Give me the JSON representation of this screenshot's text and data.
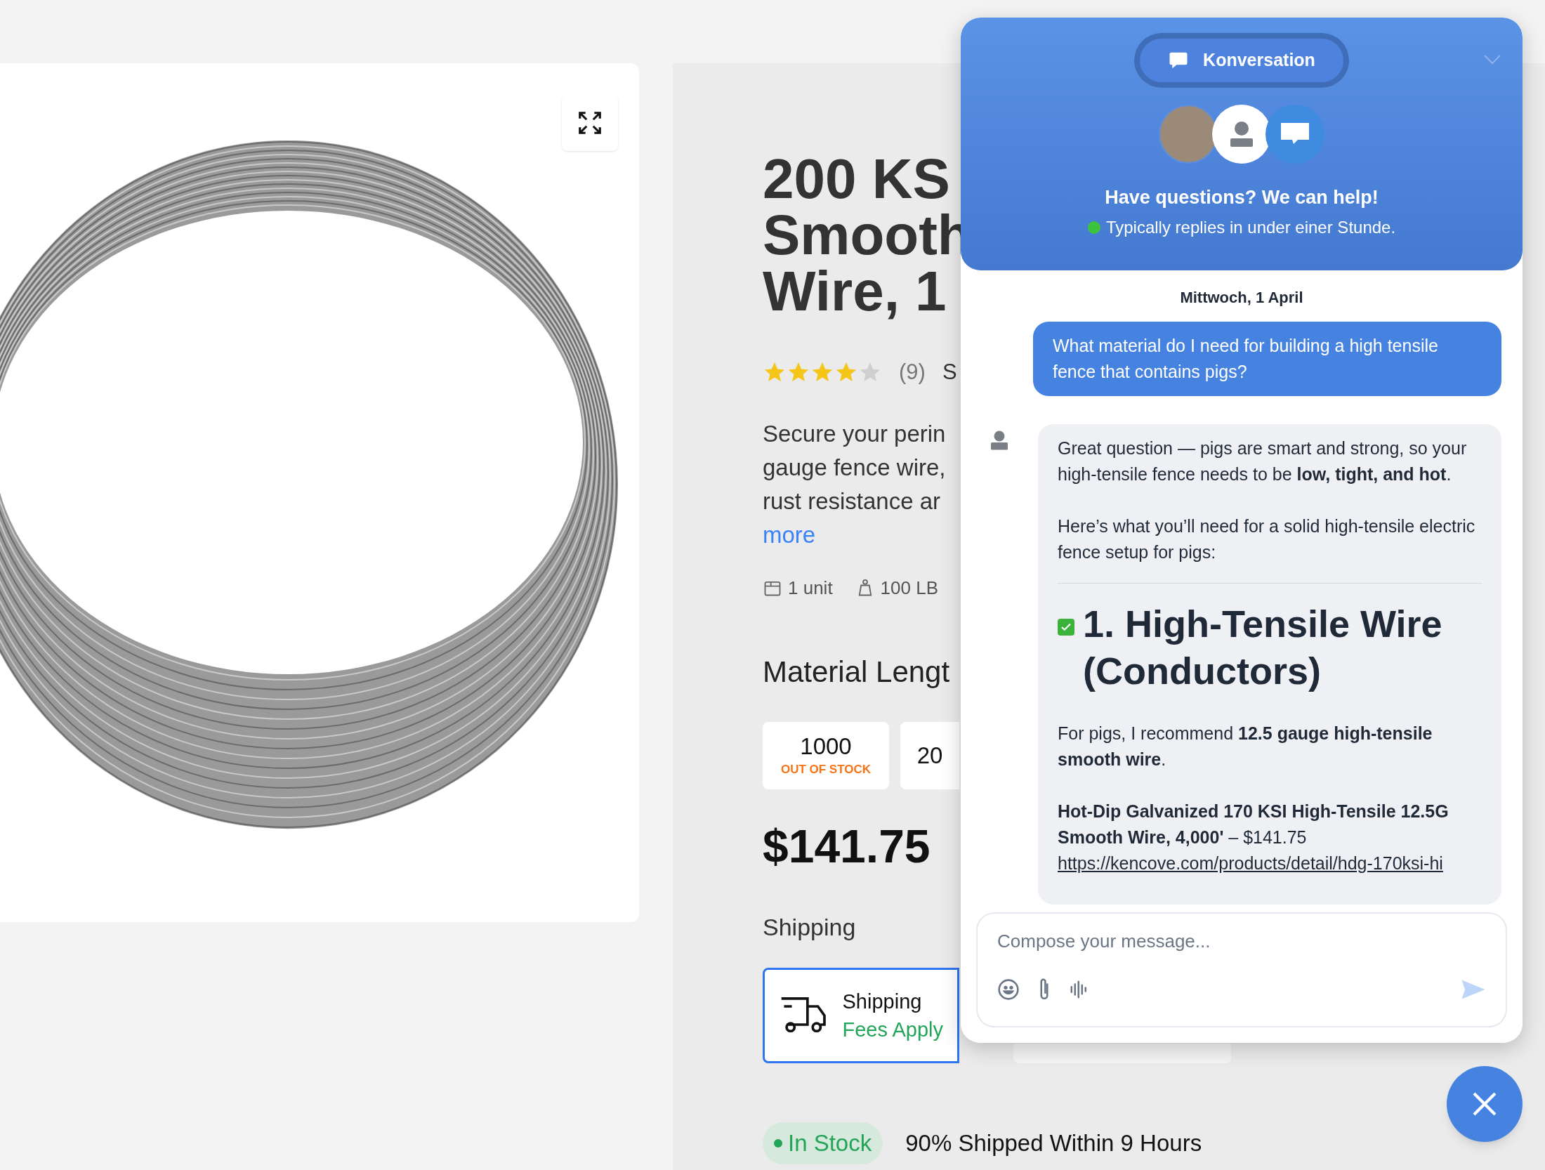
{
  "product": {
    "title_lines": [
      "200 KS",
      "Smooth",
      "Wire, 1"
    ],
    "rating": {
      "stars": 4,
      "count": "(9)",
      "cut_text": "S"
    },
    "description_lines": [
      "Secure your perin",
      "gauge fence wire,",
      "rust resistance ar"
    ],
    "more": "more",
    "specs": [
      {
        "kind": "box",
        "text": "1 unit"
      },
      {
        "kind": "weight",
        "text": "100 LB"
      }
    ],
    "material_label": "Material Lengt",
    "options": [
      {
        "value": "1000",
        "status": "OUT OF STOCK",
        "selected": false
      },
      {
        "value": "20",
        "selected": false
      }
    ],
    "price": "$141.75",
    "shipping_label": "Shipping",
    "shipping_options": [
      {
        "title": "Shipping",
        "subtitle": "Fees Apply",
        "selected": true
      },
      {
        "selected": false
      }
    ],
    "stock": {
      "badge": "In Stock",
      "note": "90% Shipped Within 9 Hours"
    }
  },
  "chat": {
    "tab": "Konversation",
    "heading": "Have questions? We can help!",
    "status": "Typically replies in under einer Stunde.",
    "online": true,
    "date": "Mittwoch, 1 April",
    "messages": [
      {
        "kind": "user",
        "text": "What material do I need for building a high tensile fence that contains pigs?"
      },
      {
        "kind": "bot",
        "blocks": [
          {
            "kind": "p",
            "text": "Great question — pigs are smart and strong, so your high-tensile fence needs to be **low, tight, and hot**."
          },
          {
            "kind": "p",
            "text": "Here’s what you’ll need for a solid high-tensile electric fence setup for pigs:"
          },
          {
            "kind": "rule"
          },
          {
            "kind": "heading",
            "text": "1. High-Tensile Wire (Conductors)"
          },
          {
            "kind": "p",
            "text": "For pigs, I recommend **12.5 gauge high-tensile smooth wire**."
          },
          {
            "kind": "product",
            "text": "**Hot-Dip Galvanized 170 KSI High-Tensile 12.5G Smooth Wire, 4,000'** – $141.75",
            "link": "https://kencove.com/products/detail/hdg-170ksi-hi"
          }
        ]
      }
    ],
    "composer": {
      "placeholder": "Compose your message..."
    }
  }
}
